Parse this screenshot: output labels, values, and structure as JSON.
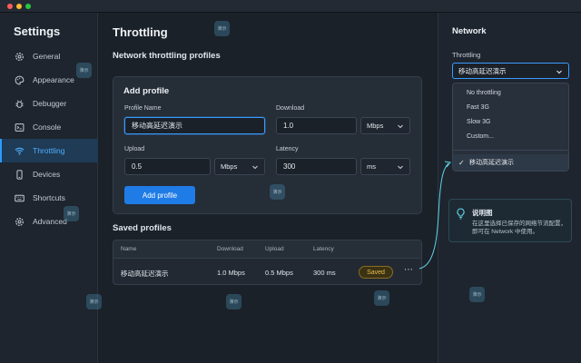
{
  "window": {
    "traffic_lights": [
      "#ff5f57",
      "#febc2e",
      "#28c840"
    ]
  },
  "sidebar": {
    "title": "Settings",
    "items": [
      {
        "label": "General",
        "icon": "gear-icon"
      },
      {
        "label": "Appearance",
        "icon": "palette-icon"
      },
      {
        "label": "Debugger",
        "icon": "bug-icon"
      },
      {
        "label": "Console",
        "icon": "terminal-icon"
      },
      {
        "label": "Throttling",
        "icon": "wifi-icon",
        "active": true
      },
      {
        "label": "Devices",
        "icon": "phone-icon"
      },
      {
        "label": "Shortcuts",
        "icon": "keyboard-icon"
      },
      {
        "label": "Advanced",
        "icon": "gear-icon"
      }
    ]
  },
  "main": {
    "title": "Throttling",
    "section_title": "Network throttling profiles",
    "add_profile": {
      "title": "Add profile",
      "profile_name_label": "Profile Name",
      "profile_name_value": "移动高延迟演示",
      "download_label": "Download",
      "download_value": "1.0",
      "download_unit": "Mbps",
      "upload_label": "Upload",
      "upload_value": "0.5",
      "upload_unit": "Mbps",
      "latency_label": "Latency",
      "latency_value": "300",
      "latency_unit": "ms",
      "button": "Add profile"
    },
    "saved": {
      "title": "Saved profiles",
      "columns": [
        "Name",
        "Download",
        "Upload",
        "Latency"
      ],
      "rows": [
        {
          "name": "移动高延迟演示",
          "download": "1.0 Mbps",
          "upload": "0.5 Mbps",
          "latency": "300 ms",
          "status": "Saved",
          "more": "⋯"
        }
      ]
    }
  },
  "panel": {
    "title": "Network",
    "throttling_label": "Throttling",
    "selected": "移动高延迟演示",
    "options": [
      "No throttling",
      "Fast 3G",
      "Slow 3G",
      "Custom..."
    ],
    "custom_option": "移动高延迟演示",
    "tip": {
      "title": "说明图",
      "body": "在这里选择已保存的网络节流配置，即可在 Network 中使用。"
    }
  },
  "colors": {
    "accent": "#2d9cff",
    "primary_button": "#1f7ce6",
    "saved_badge": "#e9bf4c",
    "connector": "#5fd3e6"
  },
  "watermark": "演示"
}
